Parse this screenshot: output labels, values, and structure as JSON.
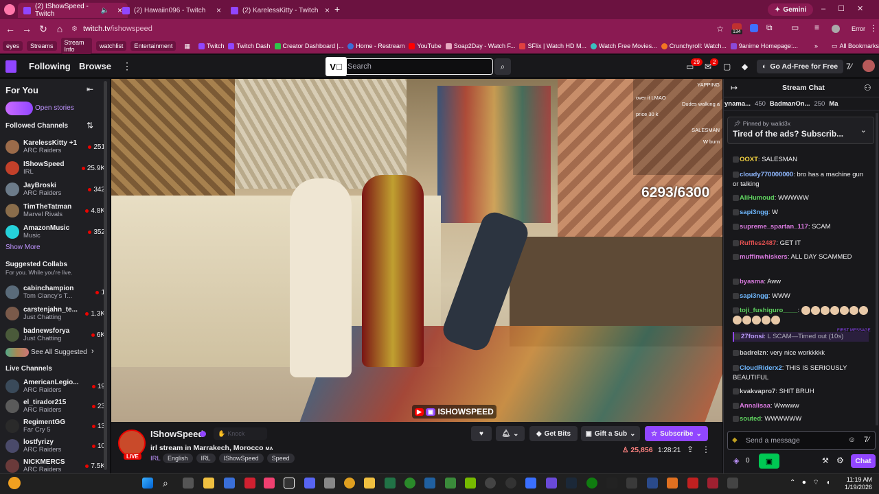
{
  "browser": {
    "tabs": [
      {
        "label": "(2) IShowSpeed - Twitch"
      },
      {
        "label": "(2) Hawaiin096 - Twitch"
      },
      {
        "label": "(2) KarelessKitty - Twitch"
      }
    ],
    "new_tab": "+",
    "gemini": "Gemini",
    "url_host": "twitch.tv",
    "url_path": "/ishowspeed",
    "ext_badge": "134",
    "error_label": "Error",
    "bookmarks": [
      {
        "label": "eyes"
      },
      {
        "label": "Streams"
      },
      {
        "label": "Stream Info"
      },
      {
        "label": "watchlist"
      },
      {
        "label": "Entertainment"
      }
    ],
    "bookmark_links": [
      "Twitch",
      "Twitch Dash",
      "Creator Dashboard |...",
      "Home - Restream",
      "YouTube",
      "Soap2Day - Watch F...",
      "SFlix | Watch HD M...",
      "Watch Free Movies...",
      "Crunchyroll: Watch...",
      "9anime Homepage:..."
    ],
    "more_bookmarks": "»",
    "all_bookmarks": "All Bookmarks"
  },
  "topnav": {
    "following": "Following",
    "browse": "Browse",
    "search_placeholder": "Search",
    "notif_count": "29",
    "inbox_count": "2",
    "ad_free": "Go Ad-Free for Free"
  },
  "sidebar": {
    "for_you": "For You",
    "open_stories": "Open stories",
    "followed_title": "Followed Channels",
    "followed": [
      {
        "name": "KarelessKitty +1",
        "game": "ARC Raiders",
        "viewers": "251",
        "color": "#9b6b4a"
      },
      {
        "name": "IShowSpeed",
        "game": "IRL",
        "viewers": "25.9K",
        "color": "#c2402a"
      },
      {
        "name": "JayBroski",
        "game": "ARC Raiders",
        "viewers": "342",
        "color": "#6c7b8a"
      },
      {
        "name": "TimTheTatman",
        "game": "Marvel Rivals",
        "viewers": "4.8K",
        "color": "#8a6d4b"
      },
      {
        "name": "AmazonMusic",
        "game": "Music",
        "viewers": "352",
        "color": "#25d1da"
      }
    ],
    "show_more": "Show More",
    "suggested_title": "Suggested Collabs",
    "suggested_sub": "For you. While you're live.",
    "suggested": [
      {
        "name": "cabinchampion",
        "game": "Tom Clancy's T...",
        "viewers": "1",
        "color": "#5a6b7a"
      },
      {
        "name": "carstenjahn_te...",
        "game": "Just Chatting",
        "viewers": "1.3K",
        "color": "#7a5a4a"
      },
      {
        "name": "badnewsforya",
        "game": "Just Chatting",
        "viewers": "6K",
        "color": "#4a5a3a"
      }
    ],
    "see_all": "See All Suggested",
    "live_title": "Live Channels",
    "live": [
      {
        "name": "AmericanLegio...",
        "game": "ARC Raiders",
        "viewers": "19",
        "color": "#3a4a5a"
      },
      {
        "name": "el_tirador215",
        "game": "ARC Raiders",
        "viewers": "23",
        "color": "#5a5a5a"
      },
      {
        "name": "RegimentGG",
        "game": "Far Cry 5",
        "viewers": "13",
        "color": "#2a2a2a"
      },
      {
        "name": "lostfyrizy",
        "game": "ARC Raiders",
        "viewers": "10",
        "color": "#4a4a6a"
      },
      {
        "name": "NICKMERCS",
        "game": "ARC Raiders",
        "viewers": "7.5K",
        "color": "#6a3a3a"
      }
    ]
  },
  "video": {
    "counter": "6293/6300",
    "overlay_chat": [
      "YAPPING",
      "over it LMAO",
      "Dudes walking a",
      "price 30 k",
      "SALESMAN",
      "W burn"
    ],
    "watermark": "ISHOWSPEED"
  },
  "stream": {
    "channel": "IShowSpeed",
    "knock": "Knock",
    "live": "LIVE",
    "title": "irl stream in Marrakech, Morocco",
    "region": "MA",
    "tags": [
      "IRL",
      "English",
      "IRL",
      "IShowSpeed",
      "Speed"
    ],
    "viewers": "25,856",
    "uptime": "1:28:21",
    "get_bits": "Get Bits",
    "gift_sub": "Gift a Sub",
    "subscribe": "Subscribe"
  },
  "chat": {
    "title": "Stream Chat",
    "leaderboard": [
      {
        "name": "ynama...",
        "score": "450"
      },
      {
        "name": "BadmanOn...",
        "score": "250"
      },
      {
        "name": "Ma",
        "score": ""
      }
    ],
    "pinned_by": "Pinned by",
    "pinned_user": "walid3x",
    "pinned_text": "Tired of the ads? Subscrib...",
    "messages": [
      {
        "user": "OOXT",
        "text": "SALESMAN",
        "color": "#f5d442"
      },
      {
        "user": "cloudy770000000",
        "text": "bro has a machine gun or talking",
        "color": "#8fb8ff"
      },
      {
        "user": "AliHumoud",
        "text": "WWWWW",
        "color": "#5fd35f"
      },
      {
        "user": "sapi3ngg",
        "text": "W",
        "color": "#6fb8ff"
      },
      {
        "user": "supreme_spartan_117",
        "text": "SCAM",
        "color": "#d97adf"
      },
      {
        "user": "Ruffles2487",
        "text": "GET IT",
        "color": "#e05050"
      },
      {
        "user": "muffinwhiskers",
        "text": "ALL DAY SCAMMED",
        "color": "#d97adf"
      },
      {
        "user": "byasma",
        "text": "Aww",
        "color": "#d97adf"
      },
      {
        "user": "sapi3ngg",
        "text": "WWW",
        "color": "#6fb8ff"
      },
      {
        "user": "toji_fushiguro____",
        "text": "",
        "color": "#5fd35f"
      },
      {
        "user": "27fonsi",
        "text": "L SCAM—Timed out (10s)",
        "color": "#c0a0ff"
      },
      {
        "user": "badrelzn",
        "text": "very nice workkkkk",
        "color": "#d0d0d0"
      },
      {
        "user": "CloudRiderx2",
        "text": "THIS IS SERIOUSLY BEAUTIFUL",
        "color": "#6fb8ff"
      },
      {
        "user": "kvakvapro7",
        "text": "SHIT BRUH",
        "color": "#d0d0d0"
      },
      {
        "user": "Annalisaa",
        "text": "Wwwww",
        "color": "#d97adf"
      },
      {
        "user": "souted",
        "text": "WWWWWW",
        "color": "#5fd35f"
      }
    ],
    "first_message": "FIRST MESSAGE",
    "placeholder": "Send a message",
    "points": "0",
    "chat_button": "Chat"
  },
  "taskbar": {
    "time": "11:19 AM",
    "date": "1/19/2026"
  }
}
